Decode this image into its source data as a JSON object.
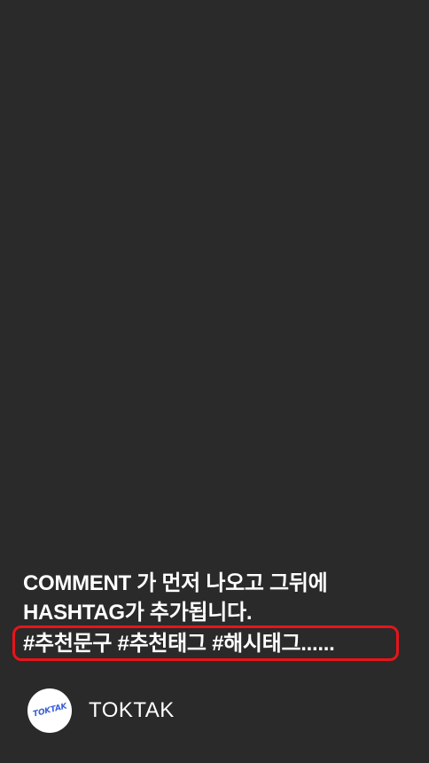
{
  "caption": {
    "line1": "COMMENT 가 먼저 나오고 그뒤에",
    "line2": "HASHTAG가 추가됩니다."
  },
  "hashtags": "#추천문구 #추천태그 #해시태그......",
  "account": {
    "name": "TOKTAK",
    "avatar_text": "TOKTAK"
  },
  "colors": {
    "background": "#2a2a2a",
    "highlight_border": "#e8141a",
    "avatar_text": "#3a5fd9"
  }
}
